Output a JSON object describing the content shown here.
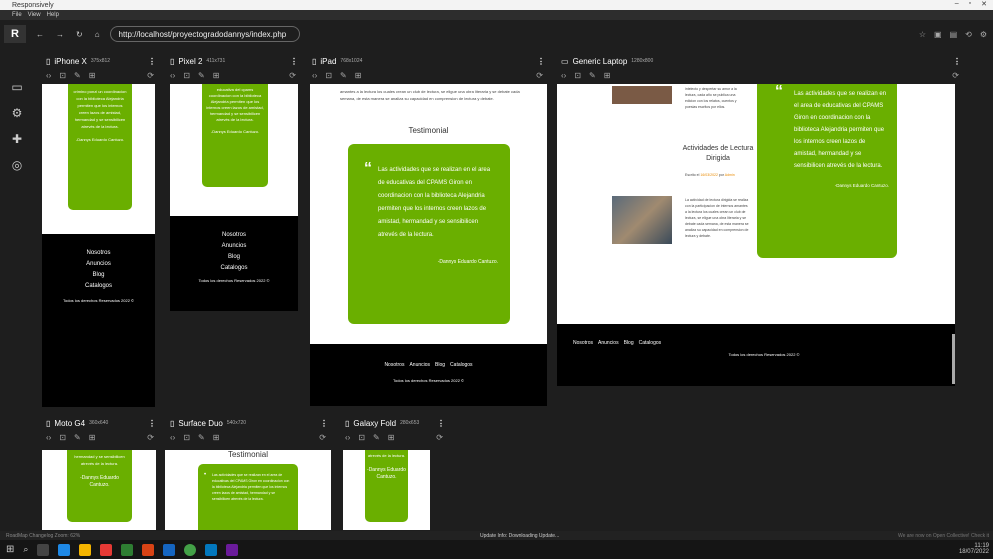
{
  "app": {
    "title": "Responsively",
    "window_controls": [
      "–",
      "▫",
      "✕"
    ]
  },
  "menu": [
    "File",
    "View",
    "Help"
  ],
  "address": {
    "url": "http://localhost/proyectogradodannys/index.php"
  },
  "devices": [
    {
      "name": "iPhone X",
      "size": "375x812"
    },
    {
      "name": "Pixel 2",
      "size": "411x731"
    },
    {
      "name": "iPad",
      "size": "768x1024"
    },
    {
      "name": "Generic Laptop",
      "size": "1280x800"
    },
    {
      "name": "Moto G4",
      "size": "360x640"
    },
    {
      "name": "Surface Duo",
      "size": "540x720"
    },
    {
      "name": "Galaxy Fold",
      "size": "280x653"
    }
  ],
  "site": {
    "testimonial_heading": "Testimonial",
    "testimonial_text": "Las actividades que se realizan en el area de educativas del CPAMS Giron en coordinacion con la biblioteca Alejandria permiten que los internos creen lazos de amistad, hermandad y se sensibilicen atrevés de la lectura.",
    "author": "-Dannys Eduardo Cantuzo.",
    "nav": [
      "Nosotros",
      "Anuncios",
      "Blog",
      "Catalogos"
    ],
    "copyright": "Todos los derechos Reservados 2022 ©",
    "ipad_para": "amantes a la lectura los cuales crean un club de lectura, se eligue una obra literaria y se debate cada semana, de esta manera se analiza su capacidad en comprension de lectura y debate.",
    "iphone_text": "crimino ponzi un coordinacion con la biblioteca Alejandria permiten que los internos creen lazos de amistad, hermandad y se sensibilicen atrevés de la lectura.",
    "pixel_text": "educativa del cpams coordinacion con la biblioteca Alejandria permiten que los internos creen lazos de amistad, hermandad y se sensibilicen atrevés de la lectura.",
    "laptop_left_top": "intelecto y despertar su amor a la lectura, cada año se publica una edicion con los relatos, cuentos y poesias escritos por ellos.",
    "laptop_post_title": "Actividades de Lectura Dirigida",
    "laptop_post_meta_prefix": "Escrito el",
    "laptop_post_date": "16/03/2022",
    "laptop_post_by": "por",
    "laptop_post_author": "Admin",
    "laptop_post_body": "La actividad de lectura dirigida se realiza con la participacion de internos amantes a la lectura los cuales crean un club de lectura, se eligue una obra literaria y se debate cada semana, de esta manera se analiza su capacidad en comprension de lectura y debate.",
    "moto_text": "hermandad y se sensibilicen atrevés de la lectura.",
    "fold_text": "atrevés de la lectura."
  },
  "statusbar": {
    "left": "RoadMap   Changelog   Zoom: 62%",
    "mid": "Update Info: Downloading Update...",
    "right": "We are now on Open Collective! Check it"
  },
  "taskbar": {
    "time": "11:19",
    "date": "18/07/2022"
  },
  "colors": {
    "accent_green": "#6aaf00",
    "bg": "#1e1e1e"
  }
}
